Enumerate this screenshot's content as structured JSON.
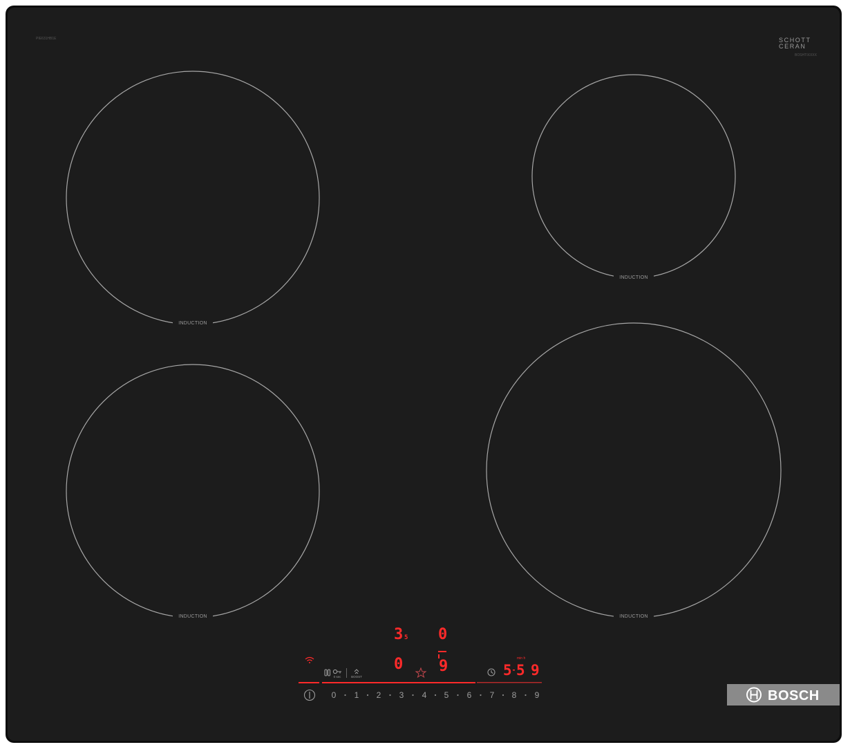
{
  "cooktop": {
    "model_number": "PIE631HB1E",
    "glass_brand": [
      "SCHOTT",
      "CERAN"
    ],
    "glass_subtext": "BOSHTIXXXX",
    "brand": "BOSCH",
    "zones": [
      {
        "id": "rear-left",
        "label": "INDUCTION"
      },
      {
        "id": "rear-right",
        "label": "INDUCTION"
      },
      {
        "id": "front-left",
        "label": "INDUCTION"
      },
      {
        "id": "front-right",
        "label": "INDUCTION"
      }
    ],
    "display": {
      "rear_left_level": "3",
      "rear_left_sub": "5",
      "rear_right_level": "0",
      "front_left_level": "0",
      "front_right_level": "9",
      "timer_digits": [
        "5",
        "5",
        "9"
      ],
      "timer_label": "min h"
    },
    "controls": {
      "lock_label": "0 sec",
      "boost_label": "BOOST",
      "scale": [
        "0",
        "1",
        "2",
        "3",
        "4",
        "5",
        "6",
        "7",
        "8",
        "9"
      ]
    },
    "colors": {
      "glass": "#1c1c1c",
      "frame": "#0d0d0d",
      "led": "#ff2a2a",
      "ring": "#a7a7a7",
      "badge": "#8a8a8a"
    }
  }
}
